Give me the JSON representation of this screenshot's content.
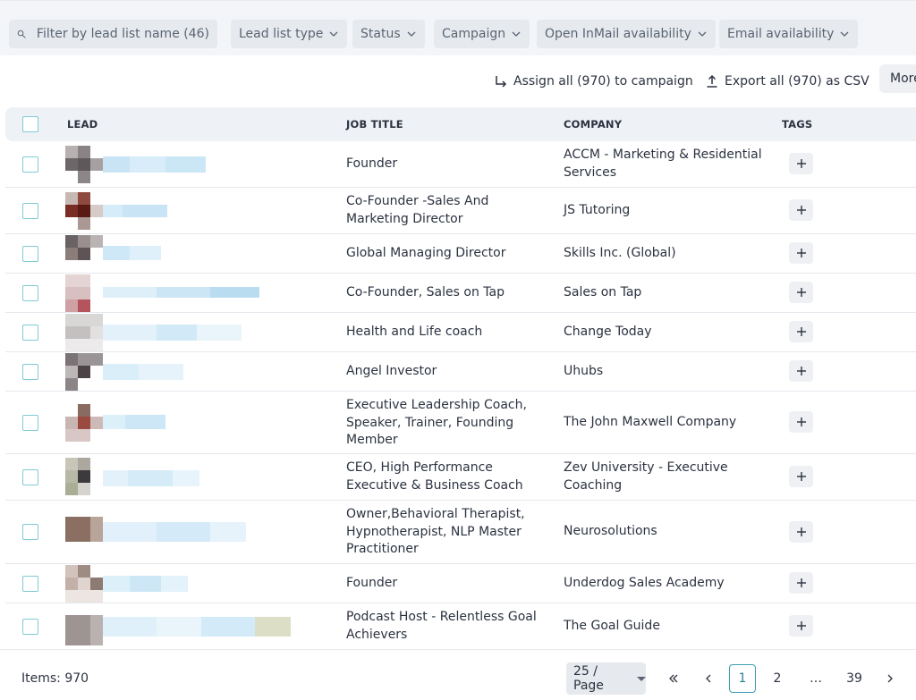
{
  "filters": {
    "search_placeholder": "Filter by lead list name (46)",
    "lead_list_type": "Lead list type",
    "status": "Status",
    "campaign": "Campaign",
    "open_inmail": "Open InMail availability",
    "email": "Email availability"
  },
  "actions": {
    "assign": "Assign all (970) to campaign",
    "export": "Export all (970) as CSV",
    "more": "More"
  },
  "table": {
    "columns": {
      "lead": "LEAD",
      "job_title": "JOB TITLE",
      "company": "COMPANY",
      "tags": "TAGS"
    },
    "rows": [
      {
        "job_title": "Founder",
        "company": "ACCM - Marketing & Residential Services"
      },
      {
        "job_title": "Co-Founder -Sales And Marketing Director",
        "company": "JS Tutoring"
      },
      {
        "job_title": "Global Managing Director",
        "company": "Skills Inc. (Global)"
      },
      {
        "job_title": "Co-Founder, Sales on Tap",
        "company": "Sales on Tap"
      },
      {
        "job_title": "Health and Life coach",
        "company": "Change Today"
      },
      {
        "job_title": "Angel Investor",
        "company": "Uhubs"
      },
      {
        "job_title": "Executive Leadership Coach, Speaker, Trainer, Founding Member",
        "company": "The John Maxwell Company"
      },
      {
        "job_title": "CEO, High Performance Executive & Business Coach",
        "company": "Zev University - Executive Coaching"
      },
      {
        "job_title": "Owner,Behavioral Therapist, Hypnotherapist, NLP Master Practitioner",
        "company": "Neurosolutions"
      },
      {
        "job_title": "Founder",
        "company": "Underdog Sales Academy"
      },
      {
        "job_title": "Podcast Host - Relentless Goal Achievers",
        "company": "The Goal Guide"
      }
    ]
  },
  "footer": {
    "items": "Items: 970",
    "per_page": "25 / Page",
    "pages": [
      "1",
      "2",
      "…",
      "39"
    ]
  }
}
